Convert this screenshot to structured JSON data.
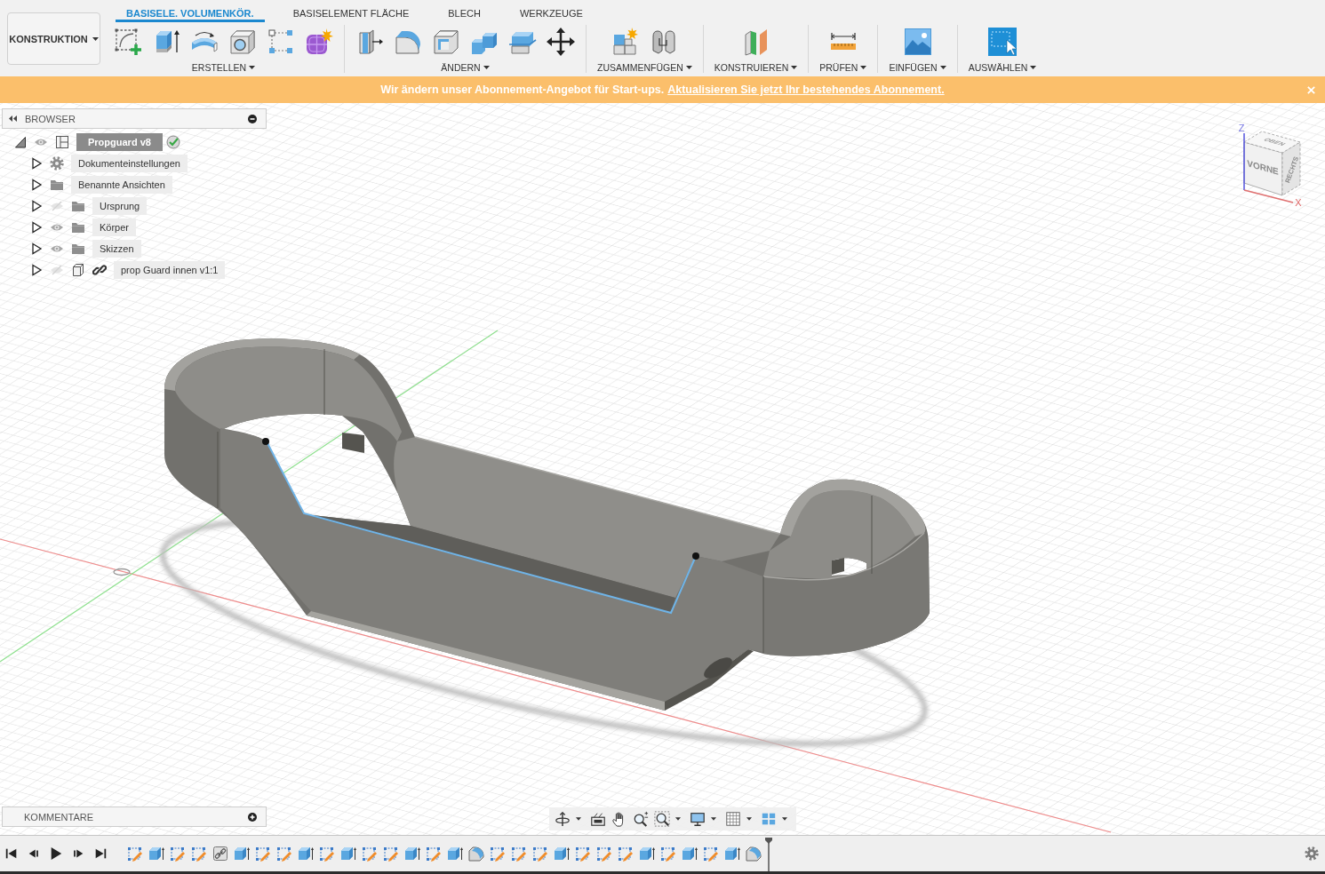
{
  "toolbar": {
    "workspace": "KONSTRUKTION",
    "tabs": [
      {
        "label": "BASISELE. VOLUMENKÖR.",
        "selected": true
      },
      {
        "label": "BASISELEMENT FLÄCHE",
        "selected": false
      },
      {
        "label": "BLECH",
        "selected": false
      },
      {
        "label": "WERKZEUGE",
        "selected": false
      }
    ],
    "groups": [
      {
        "label": "ERSTELLEN",
        "tools": [
          {
            "kind": "sketch"
          },
          {
            "kind": "extrude"
          },
          {
            "kind": "revolve"
          },
          {
            "kind": "hole"
          },
          {
            "kind": "pattern"
          },
          {
            "kind": "form"
          }
        ]
      },
      {
        "label": "ÄNDERN",
        "tools": [
          {
            "kind": "presspull"
          },
          {
            "kind": "fillet"
          },
          {
            "kind": "shell"
          },
          {
            "kind": "combine"
          },
          {
            "kind": "split"
          },
          {
            "kind": "move"
          }
        ]
      },
      {
        "label": "ZUSAMMENFÜGEN",
        "tools": [
          {
            "kind": "component"
          },
          {
            "kind": "joint"
          }
        ]
      },
      {
        "label": "KONSTRUIEREN",
        "tools": [
          {
            "kind": "plane"
          }
        ]
      },
      {
        "label": "PRÜFEN",
        "tools": [
          {
            "kind": "measure"
          }
        ]
      },
      {
        "label": "EINFÜGEN",
        "tools": [
          {
            "kind": "image"
          }
        ]
      },
      {
        "label": "AUSWÄHLEN",
        "tools": [
          {
            "kind": "select"
          }
        ]
      }
    ]
  },
  "banner": {
    "message": "Wir ändern unser Abonnement-Angebot für Start-ups.",
    "link": "Aktualisieren Sie jetzt Ihr bestehendes Abonnement."
  },
  "browser": {
    "title": "BROWSER",
    "tree": [
      {
        "label": "Propguard v8",
        "kind": "root",
        "expanded": true,
        "selected": true,
        "visible": true,
        "children": [
          {
            "label": "Dokumenteinstellungen",
            "kind": "settings",
            "expanded": false,
            "selected": false
          },
          {
            "label": "Benannte Ansichten",
            "kind": "views",
            "expanded": false,
            "selected": false
          },
          {
            "label": "Ursprung",
            "kind": "folder",
            "expanded": false,
            "selected": false,
            "visible": false
          },
          {
            "label": "Körper",
            "kind": "folder",
            "expanded": false,
            "selected": false,
            "visible": true
          },
          {
            "label": "Skizzen",
            "kind": "folder",
            "expanded": false,
            "selected": false,
            "visible": true
          },
          {
            "label": "prop Guard innen v1:1",
            "kind": "occurrence",
            "expanded": false,
            "selected": false,
            "visible": false
          }
        ]
      }
    ]
  },
  "viewcube": {
    "top": "OBEN",
    "front": "VORNE",
    "right": "RECHTS",
    "z_label": "Z",
    "x_label": "X"
  },
  "comments": {
    "title": "KOMMENTARE"
  },
  "timeline": {
    "features": [
      {
        "kind": "sketch"
      },
      {
        "kind": "extrude"
      },
      {
        "kind": "sketch"
      },
      {
        "kind": "sketch"
      },
      {
        "kind": "link"
      },
      {
        "kind": "extrude"
      },
      {
        "kind": "sketch"
      },
      {
        "kind": "sketch"
      },
      {
        "kind": "extrude"
      },
      {
        "kind": "sketch"
      },
      {
        "kind": "extrude"
      },
      {
        "kind": "sketch"
      },
      {
        "kind": "sketch"
      },
      {
        "kind": "extrude"
      },
      {
        "kind": "sketch"
      },
      {
        "kind": "extrude"
      },
      {
        "kind": "fillet"
      },
      {
        "kind": "sketch"
      },
      {
        "kind": "sketch"
      },
      {
        "kind": "sketch"
      },
      {
        "kind": "extrude"
      },
      {
        "kind": "sketch"
      },
      {
        "kind": "sketch"
      },
      {
        "kind": "sketch"
      },
      {
        "kind": "extrude"
      },
      {
        "kind": "sketch"
      },
      {
        "kind": "extrude"
      },
      {
        "kind": "sketch"
      },
      {
        "kind": "extrude"
      },
      {
        "kind": "fillet"
      }
    ]
  }
}
